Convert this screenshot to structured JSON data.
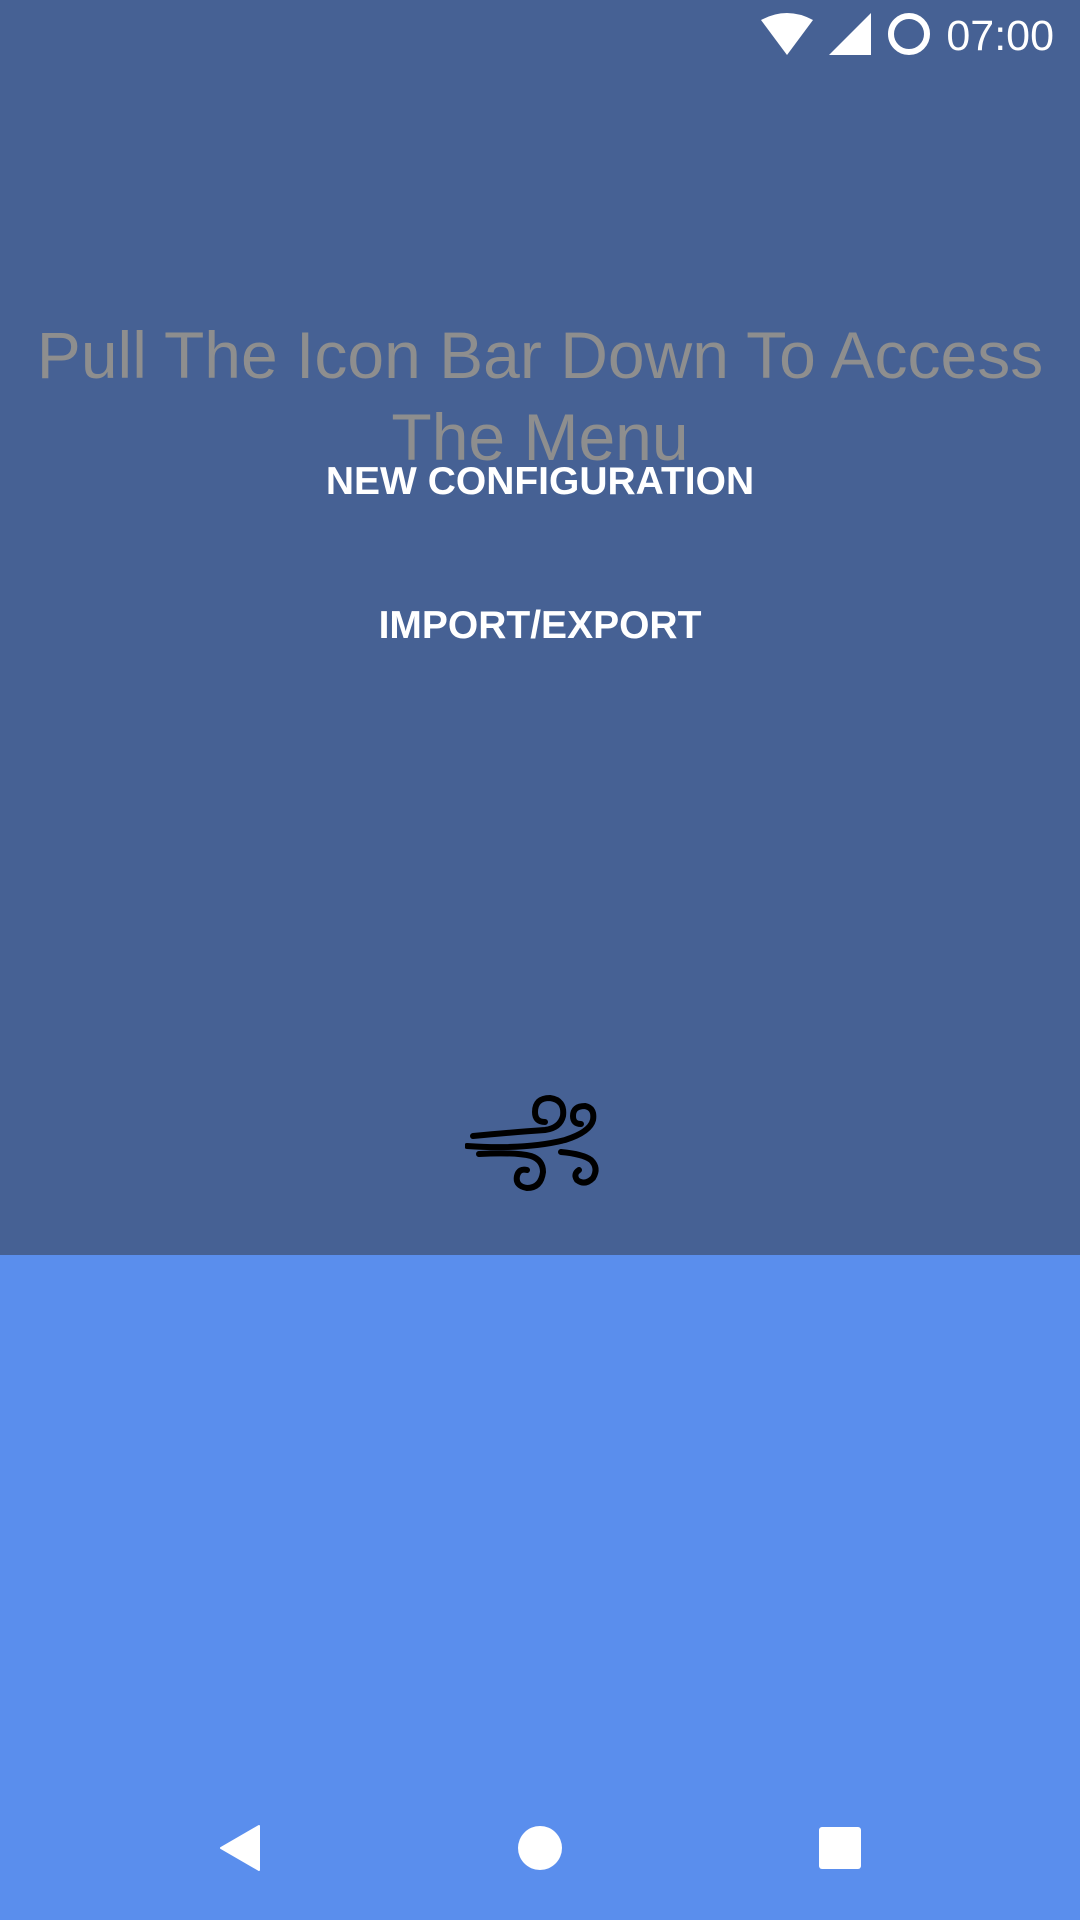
{
  "status_bar": {
    "time": "07:00",
    "icons": [
      "wifi-icon",
      "signal-icon",
      "sync-circle-icon"
    ]
  },
  "main": {
    "hint": "Pull The Icon Bar Down To Access The Menu",
    "buttons": {
      "new_configuration": "NEW CONFIGURATION",
      "import_export": "IMPORT/EXPORT"
    },
    "pull_handle_icon": "wind-icon"
  },
  "nav_bar": {
    "icons": [
      "back-icon",
      "home-icon",
      "recents-icon"
    ]
  },
  "colors": {
    "top_panel": "#466194",
    "bottom_panel": "#5a8eed",
    "hint_text": "#8e8e8e",
    "button_text": "#ffffff"
  }
}
